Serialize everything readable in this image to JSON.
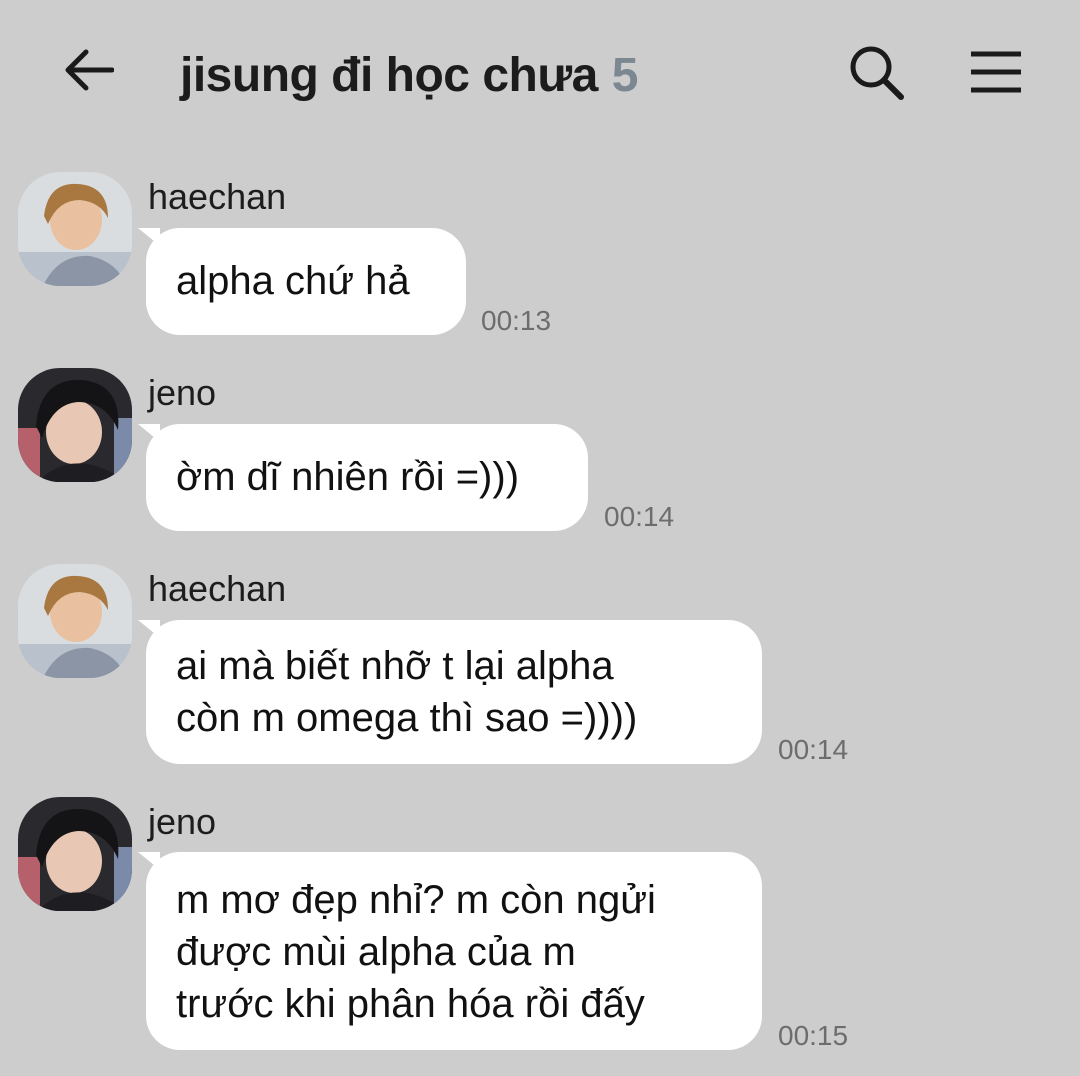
{
  "header": {
    "title": "jisung đi học chưa",
    "member_count": "5",
    "back_icon": "arrow-left-icon",
    "search_icon": "search-icon",
    "menu_icon": "hamburger-menu-icon"
  },
  "messages": [
    {
      "sender": "haechan",
      "avatar": "haechan-avatar",
      "text": "alpha chứ hả",
      "time": "00:13"
    },
    {
      "sender": "jeno",
      "avatar": "jeno-avatar",
      "text": "ờm dĩ nhiên rồi =)))",
      "time": "00:14"
    },
    {
      "sender": "haechan",
      "avatar": "haechan-avatar",
      "text": "ai mà biết nhỡ t lại alpha\ncòn m omega thì sao =))))",
      "time": "00:14"
    },
    {
      "sender": "jeno",
      "avatar": "jeno-avatar",
      "text": "m mơ đẹp nhỉ? m còn ngửi\nđược mùi alpha của m\ntrước khi phân hóa rồi đấy",
      "time": "00:15"
    }
  ],
  "colors": {
    "background": "#cdcdcd",
    "bubble": "#ffffff",
    "count": "#7b8791",
    "timestamp": "#6d6d6d"
  }
}
